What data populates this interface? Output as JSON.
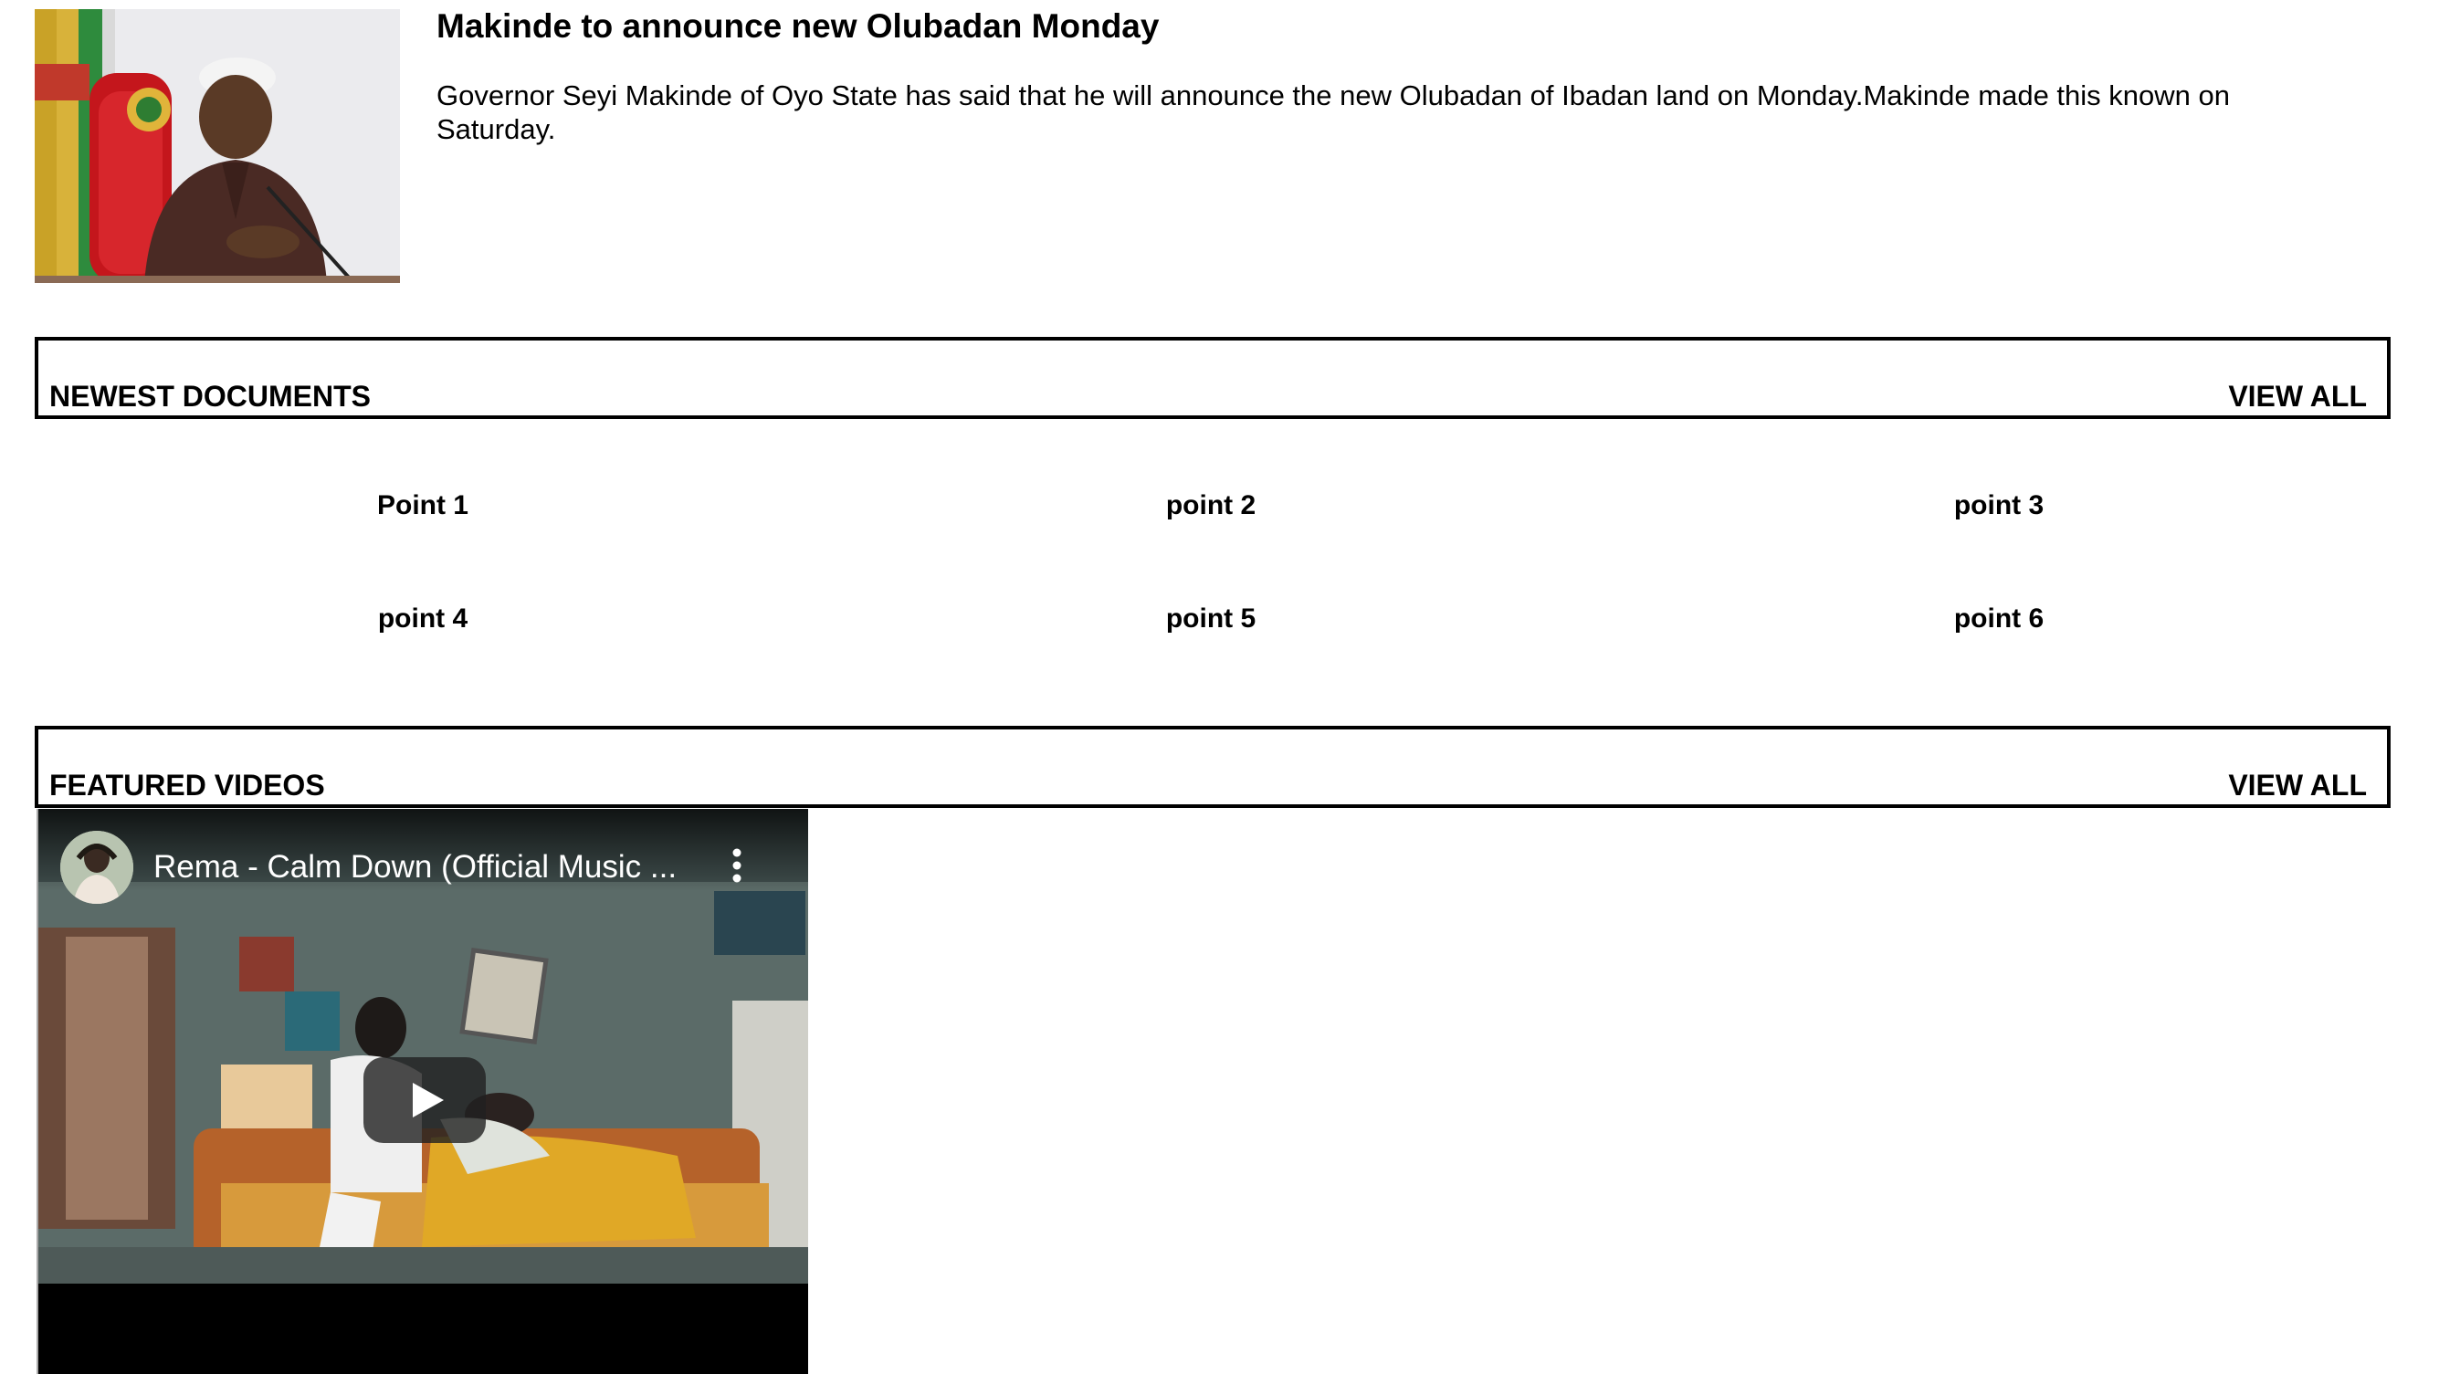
{
  "article": {
    "title": "Makinde to announce new Olubadan Monday",
    "body": "Governor Seyi Makinde of Oyo State has said that he will announce the new Olubadan of Ibadan land on Monday.Makinde made this known on Saturday."
  },
  "newest_documents": {
    "heading": "NEWEST DOCUMENTS",
    "view_all": "VIEW ALL",
    "points": [
      "Point 1",
      "point 2",
      "point 3",
      "point 4",
      "point 5",
      "point 6"
    ]
  },
  "featured_videos": {
    "heading": "FEATURED VIDEOS",
    "view_all": "VIEW ALL",
    "video": {
      "title": "Rema - Calm Down (Official Music ...",
      "icons": [
        "channel-avatar",
        "more-vert-icon",
        "play-icon"
      ]
    }
  }
}
